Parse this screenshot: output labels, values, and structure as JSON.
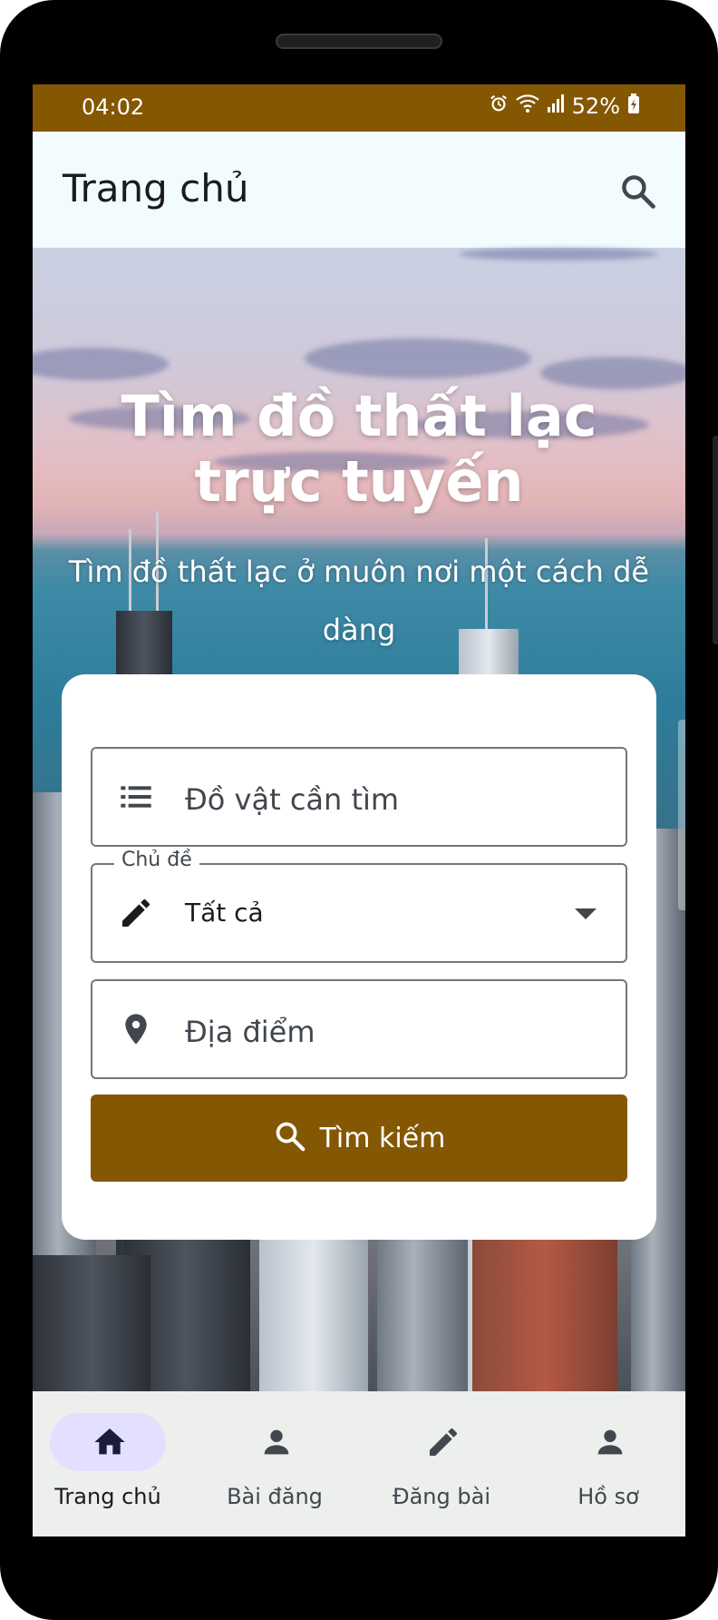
{
  "status_bar": {
    "time": "04:02",
    "battery": "52%",
    "icons": [
      "alarm-icon",
      "wifi-icon",
      "signal-icon",
      "battery-charging-icon"
    ]
  },
  "app_bar": {
    "title": "Trang chủ",
    "search_icon": "search-icon"
  },
  "hero": {
    "title": "Tìm đồ thất lạc trực tuyến",
    "subtitle": "Tìm đồ thất lạc ở muôn nơi một cách dễ dàng"
  },
  "search_form": {
    "item_field": {
      "placeholder": "Đồ vật cần tìm",
      "icon": "list-icon"
    },
    "topic_field": {
      "label": "Chủ đề",
      "value": "Tất cả",
      "icon": "pencil-icon"
    },
    "location_field": {
      "placeholder": "Địa điểm",
      "icon": "location-pin-icon"
    },
    "search_button": {
      "label": "Tìm kiếm",
      "icon": "search-icon"
    }
  },
  "bottom_nav": {
    "items": [
      {
        "label": "Trang chủ",
        "icon": "home-icon",
        "active": true
      },
      {
        "label": "Bài đăng",
        "icon": "person-icon",
        "active": false
      },
      {
        "label": "Đăng bài",
        "icon": "pencil-icon",
        "active": false
      },
      {
        "label": "Hồ sơ",
        "icon": "person-icon",
        "active": false
      }
    ]
  },
  "colors": {
    "primary": "#845703",
    "app_bar_bg": "#f2fcff",
    "nav_bg": "#ecefec",
    "nav_active_pill": "#e3dfff"
  }
}
